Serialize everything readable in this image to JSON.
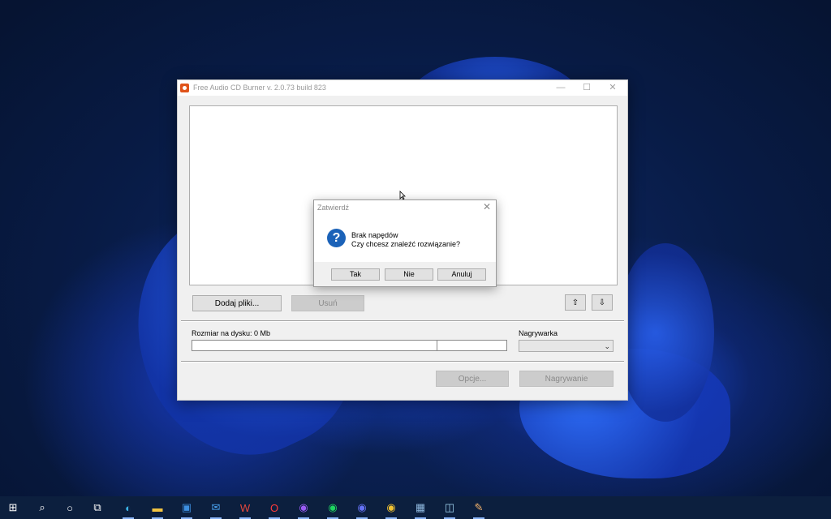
{
  "window": {
    "title": "Free Audio CD Burner  v. 2.0.73 build 823",
    "minimize": "—",
    "maximize": "☐",
    "close": "✕",
    "buttons": {
      "add_files": "Dodaj pliki...",
      "remove": "Usuń",
      "move_up": "⇧",
      "move_down": "⇩",
      "options": "Opcje...",
      "burn": "Nagrywanie"
    },
    "disk_size_label": "Rozmiar na dysku:  0 Mb",
    "burner_label": "Nagrywarka",
    "burner_value": "",
    "combo_arrow": "⌄"
  },
  "dialog": {
    "title": "Zatwierdź",
    "close": "✕",
    "icon": "?",
    "line1": "Brak napędów",
    "line2": "Czy chcesz znaleźć rozwiązanie?",
    "buttons": {
      "yes": "Tak",
      "no": "Nie",
      "cancel": "Anuluj"
    }
  },
  "taskbar": {
    "items": [
      {
        "name": "start-icon",
        "glyph": "⊞",
        "color": "#ffffff"
      },
      {
        "name": "search-icon",
        "glyph": "⌕",
        "color": "#ffffff"
      },
      {
        "name": "cortana-icon",
        "glyph": "○",
        "color": "#ffffff"
      },
      {
        "name": "task-view-icon",
        "glyph": "⧉",
        "color": "#ffffff"
      },
      {
        "name": "edge-icon",
        "glyph": "◐",
        "color": "#3bb4e8"
      },
      {
        "name": "file-explorer-icon",
        "glyph": "▬",
        "color": "#f4c542"
      },
      {
        "name": "store-icon",
        "glyph": "▣",
        "color": "#3d8fe0"
      },
      {
        "name": "mail-icon",
        "glyph": "✉",
        "color": "#4aa3f0"
      },
      {
        "name": "wps-office-icon",
        "glyph": "W",
        "color": "#e5483c"
      },
      {
        "name": "opera-icon",
        "glyph": "O",
        "color": "#ff3b3b"
      },
      {
        "name": "messenger-icon",
        "glyph": "◉",
        "color": "#9b5cf6"
      },
      {
        "name": "spotify-icon",
        "glyph": "◉",
        "color": "#1ed760"
      },
      {
        "name": "discord-icon",
        "glyph": "◉",
        "color": "#6572f5"
      },
      {
        "name": "chrome-icon",
        "glyph": "◉",
        "color": "#f1c232"
      },
      {
        "name": "calculator-icon",
        "glyph": "▦",
        "color": "#8fb8de"
      },
      {
        "name": "app-icon-1",
        "glyph": "◫",
        "color": "#9fd3ef"
      },
      {
        "name": "paint-icon",
        "glyph": "✎",
        "color": "#f3b26b"
      }
    ]
  }
}
